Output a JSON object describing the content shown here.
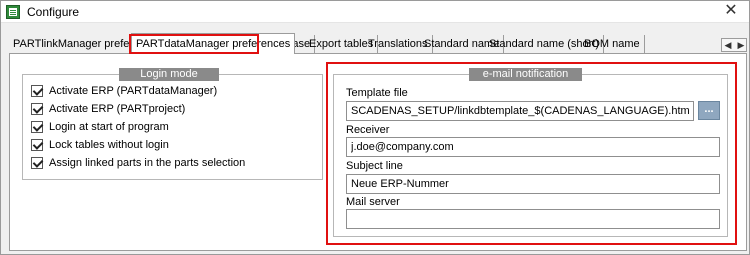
{
  "window": {
    "title": "Configure",
    "close_glyph": "✕"
  },
  "tabs": [
    {
      "label": "PARTlinkManager preferences",
      "active": false
    },
    {
      "label": "PARTdataManager preferences",
      "active": true
    },
    {
      "label": "Database",
      "active": false
    },
    {
      "label": "Export tables",
      "active": false
    },
    {
      "label": "Translations",
      "active": false
    },
    {
      "label": "Standard name",
      "active": false
    },
    {
      "label": "Standard name (short)",
      "active": false
    },
    {
      "label": "BOM name",
      "active": false
    }
  ],
  "tab_scroll": {
    "left": "◀",
    "right": "▶"
  },
  "login_mode": {
    "title": "Login mode",
    "options": [
      {
        "label": "Activate ERP (PARTdataManager)",
        "checked": true
      },
      {
        "label": "Activate ERP (PARTproject)",
        "checked": true
      },
      {
        "label": "Login at start of program",
        "checked": true
      },
      {
        "label": "Lock tables without login",
        "checked": true
      },
      {
        "label": "Assign linked parts in the parts selection",
        "checked": true
      }
    ]
  },
  "email_notification": {
    "title": "e-mail notification",
    "template_file": {
      "label": "Template file",
      "value": "SCADENAS_SETUP/linkdbtemplate_$(CADENAS_LANGUAGE).html",
      "browse_label": "..."
    },
    "receiver": {
      "label": "Receiver",
      "value": "j.doe@company.com"
    },
    "subject_line": {
      "label": "Subject line",
      "value": "Neue ERP-Nummer"
    },
    "mail_server": {
      "label": "Mail server",
      "value": ""
    }
  },
  "colors": {
    "highlight": "#e01010",
    "group_title_bg": "#8a8a8a",
    "browse_button": "#8fa7bf"
  }
}
